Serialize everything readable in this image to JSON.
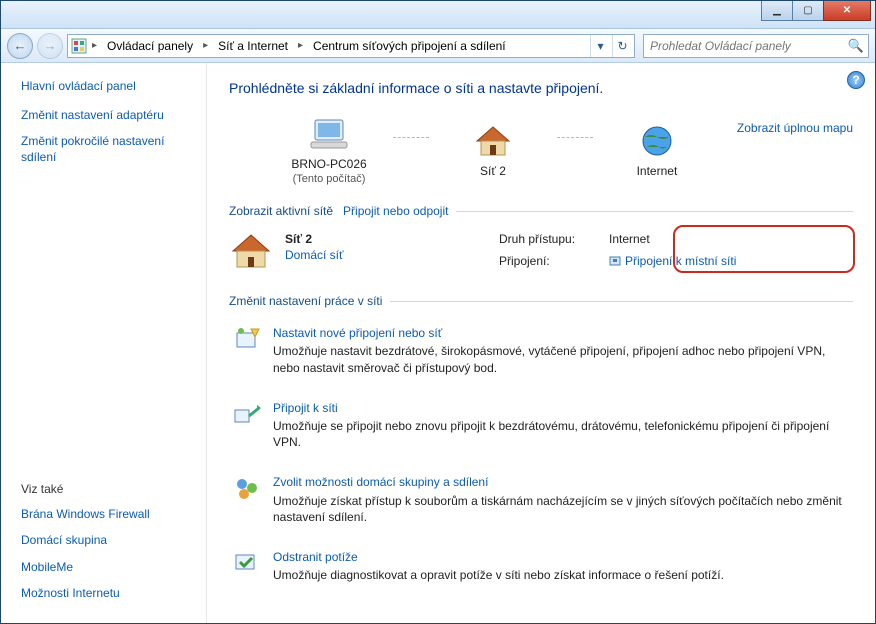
{
  "titlebar": {},
  "nav": {
    "breadcrumbs": [
      "Ovládací panely",
      "Síť a Internet",
      "Centrum síťových připojení a sdílení"
    ],
    "search_placeholder": "Prohledat Ovládací panely"
  },
  "sidebar": {
    "main": "Hlavní ovládací panel",
    "links": [
      "Změnit nastavení adaptéru",
      "Změnit pokročilé nastavení sdílení"
    ],
    "see_also_header": "Viz také",
    "see_also": [
      "Brána Windows Firewall",
      "Domácí skupina",
      "MobileMe",
      "Možnosti Internetu"
    ]
  },
  "content": {
    "title": "Prohlédněte si základní informace o síti a nastavte připojení.",
    "map": {
      "pc": "BRNO-PC026",
      "pc_sub": "(Tento počítač)",
      "net": "Síť  2",
      "internet": "Internet",
      "full_map": "Zobrazit úplnou mapu"
    },
    "active": {
      "header": "Zobrazit aktivní sítě",
      "connect_link": "Připojit nebo odpojit",
      "name": "Síť  2",
      "type": "Domácí síť",
      "access_label": "Druh přístupu:",
      "access_value": "Internet",
      "conn_label": "Připojení:",
      "conn_value": "Připojení k místní síti"
    },
    "change_header": "Změnit nastavení práce v síti",
    "tasks": [
      {
        "title": "Nastavit nové připojení nebo síť",
        "desc": "Umožňuje nastavit bezdrátové, širokopásmové, vytáčené připojení, připojení adhoc nebo připojení VPN, nebo nastavit směrovač či přístupový bod."
      },
      {
        "title": "Připojit k síti",
        "desc": "Umožňuje se připojit nebo znovu připojit k bezdrátovému, drátovému, telefonickému připojení či připojení VPN."
      },
      {
        "title": "Zvolit možnosti domácí skupiny a sdílení",
        "desc": "Umožňuje získat přístup k souborům a tiskárnám nacházejícím se v jiných síťových počítačích nebo změnit nastavení sdílení."
      },
      {
        "title": "Odstranit potíže",
        "desc": "Umožňuje diagnostikovat a opravit potíže v síti nebo získat informace o řešení potíží."
      }
    ]
  }
}
